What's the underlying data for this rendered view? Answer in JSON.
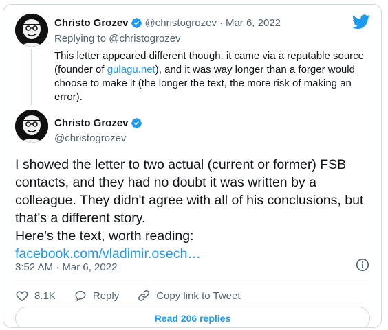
{
  "quoted_tweet": {
    "author_name": "Christo Grozev",
    "handle": "@christogrozev",
    "separator": "·",
    "date": "Mar 6, 2022",
    "replying_prefix": "Replying to ",
    "replying_to": "@christogrozev",
    "text_before_link": "This letter appeared different though: it came via a reputable source (founder of ",
    "link_text": "gulagu.net",
    "text_after_link": "), and it was way longer than a forger would choose to make it (the longer the text, the more risk of making an error)."
  },
  "main_tweet": {
    "author_name": "Christo Grozev",
    "handle": "@christogrozev",
    "text_line1": "I showed the letter to two actual (current or former) FSB contacts, and they had no doubt it was written by a colleague. They didn't agree with all of his conclusions, but that's a different story.",
    "text_line2": "Here's the text, worth reading:",
    "link_text": "facebook.com/vladimir.osech…",
    "timestamp": "3:52 AM · Mar 6, 2022"
  },
  "actions": {
    "likes_count": "8.1K",
    "reply_label": "Reply",
    "copy_link_label": "Copy link to Tweet"
  },
  "read_replies_label": "Read 206 replies",
  "icons": {
    "brand": "twitter-bird-icon",
    "verified": "verified-badge-icon",
    "info": "info-icon",
    "like": "heart-icon",
    "reply": "reply-bubble-icon",
    "copy_link": "link-icon"
  },
  "colors": {
    "accent": "#1d9bf0",
    "text": "#0f1419",
    "secondary": "#536471",
    "border": "#cfd9de"
  }
}
